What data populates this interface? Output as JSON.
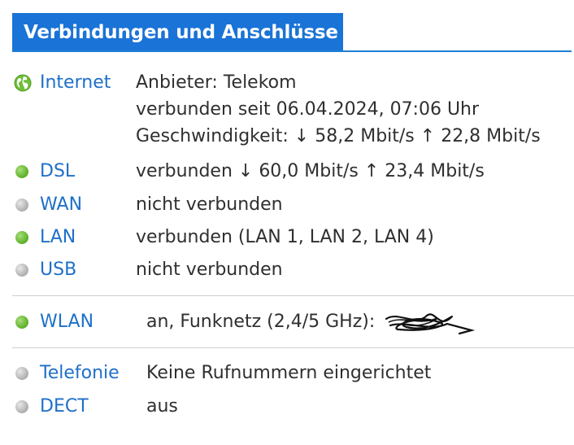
{
  "header": {
    "title": "Verbindungen und Anschlüsse"
  },
  "rows": {
    "internet": {
      "label": "Internet",
      "status": "internet-globe",
      "lines": [
        "Anbieter: Telekom",
        "verbunden seit 06.04.2024, 07:06 Uhr",
        "Geschwindigkeit: ↓ 58,2 Mbit/s ↑ 22,8 Mbit/s"
      ]
    },
    "dsl": {
      "label": "DSL",
      "status": "green",
      "value": "verbunden ↓ 60,0 Mbit/s ↑ 23,4 Mbit/s"
    },
    "wan": {
      "label": "WAN",
      "status": "grey",
      "value": "nicht verbunden"
    },
    "lan": {
      "label": "LAN",
      "status": "green",
      "value": "verbunden (LAN 1, LAN 2, LAN 4)"
    },
    "usb": {
      "label": "USB",
      "status": "grey",
      "value": "nicht verbunden"
    },
    "wlan": {
      "label": "WLAN",
      "status": "green",
      "value": "an, Funknetz (2,4/5 GHz):"
    },
    "telefonie": {
      "label": "Telefonie",
      "status": "grey",
      "value": "Keine Rufnummern eingerichtet"
    },
    "dect": {
      "label": "DECT",
      "status": "grey",
      "value": "aus"
    }
  },
  "colors": {
    "accent": "#1a73d6",
    "link": "#1e70c8",
    "status_green": "#66b531",
    "status_grey": "#b5b5b5"
  }
}
